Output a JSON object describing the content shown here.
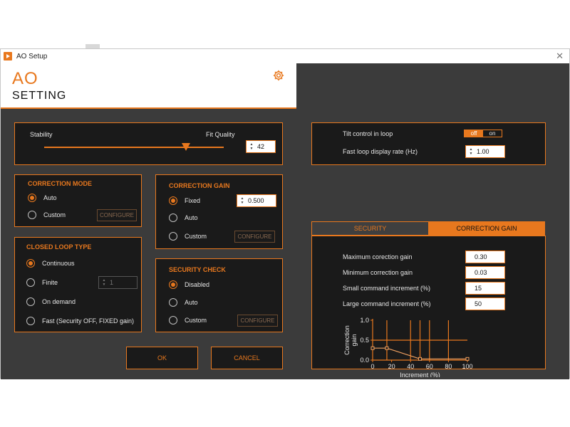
{
  "window": {
    "title": "AO Setup",
    "close_glyph": "✕"
  },
  "header": {
    "line1": "AO",
    "line2": "SETTING",
    "settings_icon": "gear-icon"
  },
  "stability": {
    "left_label": "Stability",
    "right_label": "Fit Quality",
    "value": "42",
    "slider_fraction": 0.79
  },
  "correction_mode": {
    "title": "CORRECTION MODE",
    "options": [
      {
        "label": "Auto",
        "selected": true
      },
      {
        "label": "Custom",
        "selected": false
      }
    ],
    "configure_label": "CONFIGURE"
  },
  "correction_gain": {
    "title": "CORRECTION GAIN",
    "options": [
      {
        "label": "Fixed",
        "selected": true
      },
      {
        "label": "Auto",
        "selected": false
      },
      {
        "label": "Custom",
        "selected": false
      }
    ],
    "fixed_value": "0.500",
    "configure_label": "CONFIGURE"
  },
  "closed_loop": {
    "title": "CLOSED LOOP TYPE",
    "options": [
      {
        "label": "Continuous",
        "selected": true
      },
      {
        "label": "Finite",
        "selected": false
      },
      {
        "label": "On demand",
        "selected": false
      },
      {
        "label": "Fast (Security OFF, FIXED gain)",
        "selected": false
      }
    ],
    "finite_value": "1"
  },
  "security_check": {
    "title": "SECURITY CHECK",
    "options": [
      {
        "label": "Disabled",
        "selected": true
      },
      {
        "label": "Auto",
        "selected": false
      },
      {
        "label": "Custom",
        "selected": false
      }
    ],
    "configure_label": "CONFIGURE"
  },
  "buttons": {
    "ok": "OK",
    "cancel": "CANCEL"
  },
  "loop": {
    "tilt_label": "Tilt control in loop",
    "toggle_off": "off",
    "toggle_on": "on",
    "rate_label": "Fast loop display rate (Hz)",
    "rate_value": "1.00"
  },
  "tabs": {
    "security": "SECURITY",
    "correction_gain": "CORRECTION GAIN",
    "active": "correction_gain"
  },
  "gain_params": [
    {
      "label": "Maximum corection gain",
      "value": "0.30"
    },
    {
      "label": "Minimum correction gain",
      "value": "0.03"
    },
    {
      "label": "Small command increment (%)",
      "value": "15"
    },
    {
      "label": "Large command increment (%)",
      "value": "50"
    }
  ],
  "colors": {
    "accent": "#e8781e",
    "panel": "#1a1a1a",
    "background": "#3b3b3b"
  },
  "chart_data": {
    "type": "line",
    "xlabel": "Increment (%)",
    "ylabel": "Correction gain",
    "xlim": [
      0,
      100
    ],
    "ylim": [
      0,
      1.0
    ],
    "xticks": [
      "0",
      "20",
      "40",
      "60",
      "80",
      "100"
    ],
    "yticks": [
      "0.0",
      "0.5",
      "1.0"
    ],
    "series": [
      {
        "x": [
          0,
          15,
          50,
          100
        ],
        "y": [
          0.3,
          0.3,
          0.03,
          0.03
        ]
      }
    ],
    "reference_lines": {
      "vertical_x": [
        15,
        50
      ],
      "horizontal_y": [
        0.5
      ]
    }
  }
}
